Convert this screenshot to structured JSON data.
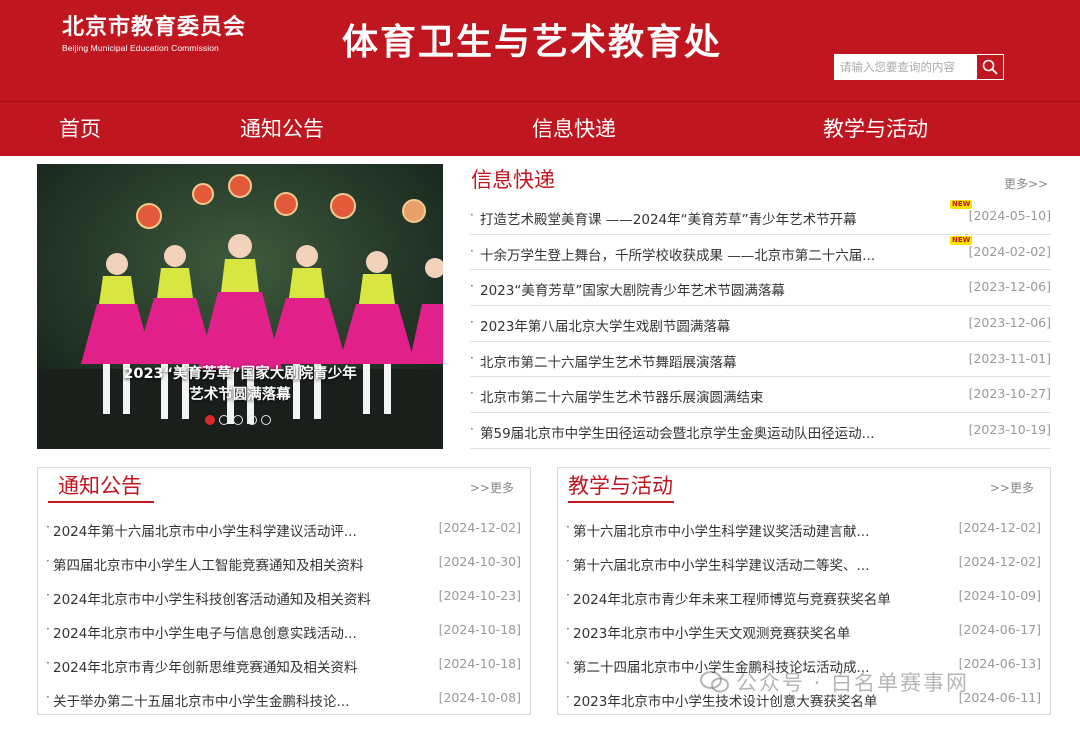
{
  "header": {
    "logo_cn": "北京市教育委员会",
    "logo_en": "Beijing Municipal Education Commission",
    "department_title": "体育卫生与艺术教育处",
    "search": {
      "placeholder": "请输入您要查询的内容",
      "value": ""
    }
  },
  "nav": {
    "items": [
      {
        "label": "首页"
      },
      {
        "label": "通知公告"
      },
      {
        "label": "信息快递"
      },
      {
        "label": "教学与活动"
      }
    ]
  },
  "banner": {
    "caption_line1": "2023“美育芳草”国家大剧院青少年",
    "caption_line2": "艺术节圆满落幕",
    "slide_count": 5,
    "active_slide": 1
  },
  "news": {
    "title": "信息快递",
    "more": "更多>>",
    "new_badge": "NEW",
    "items": [
      {
        "title": "打造艺术殿堂美育课 ——2024年“美育芳草”青少年艺术节开幕",
        "date": "[2024-05-10]",
        "is_new": true
      },
      {
        "title": "十余万学生登上舞台，千所学校收获成果 ——北京市第二十六届...",
        "date": "[2024-02-02]",
        "is_new": true
      },
      {
        "title": "2023“美育芳草”国家大剧院青少年艺术节圆满落幕",
        "date": "[2023-12-06]",
        "is_new": false
      },
      {
        "title": "2023年第八届北京大学生戏剧节圆满落幕",
        "date": "[2023-12-06]",
        "is_new": false
      },
      {
        "title": "北京市第二十六届学生艺术节舞蹈展演落幕",
        "date": "[2023-11-01]",
        "is_new": false
      },
      {
        "title": "北京市第二十六届学生艺术节器乐展演圆满结束",
        "date": "[2023-10-27]",
        "is_new": false
      },
      {
        "title": "第59届北京市中学生田径运动会暨北京学生金奥运动队田径运动...",
        "date": "[2023-10-19]",
        "is_new": false
      }
    ]
  },
  "notices": {
    "title": "通知公告",
    "more": ">>更多",
    "items": [
      {
        "title": "2024年第十六届北京市中小学生科学建议活动评...",
        "date": "[2024-12-02]"
      },
      {
        "title": "第四届北京市中小学生人工智能竞赛通知及相关资料",
        "date": "[2024-10-30]"
      },
      {
        "title": "2024年北京市中小学生科技创客活动通知及相关资料",
        "date": "[2024-10-23]"
      },
      {
        "title": "2024年北京市中小学生电子与信息创意实践活动...",
        "date": "[2024-10-18]"
      },
      {
        "title": "2024年北京市青少年创新思维竞赛通知及相关资料",
        "date": "[2024-10-18]"
      },
      {
        "title": "关于举办第二十五届北京市中小学生金鹏科技论...",
        "date": "[2024-10-08]"
      }
    ]
  },
  "activities": {
    "title": "教学与活动",
    "more": ">>更多",
    "items": [
      {
        "title": "第十六届北京市中小学生科学建议奖活动建言献...",
        "date": "[2024-12-02]"
      },
      {
        "title": "第十六届北京市中小学生科学建议活动二等奖、...",
        "date": "[2024-12-02]"
      },
      {
        "title": "2024年北京市青少年未来工程师博览与竞赛获奖名单",
        "date": "[2024-10-09]"
      },
      {
        "title": "2023年北京市中小学生天文观测竞赛获奖名单",
        "date": "[2024-06-17]"
      },
      {
        "title": "第二十四届北京市中小学生金鹏科技论坛活动成...",
        "date": "[2024-06-13]"
      },
      {
        "title": "2023年北京市中小学生技术设计创意大赛获奖名单",
        "date": "[2024-06-11]"
      }
    ]
  },
  "watermark": {
    "text": "公众号 · 白名单赛事网"
  },
  "colors": {
    "brand_red": "#c0161f",
    "text": "#333333",
    "date": "#999999"
  }
}
